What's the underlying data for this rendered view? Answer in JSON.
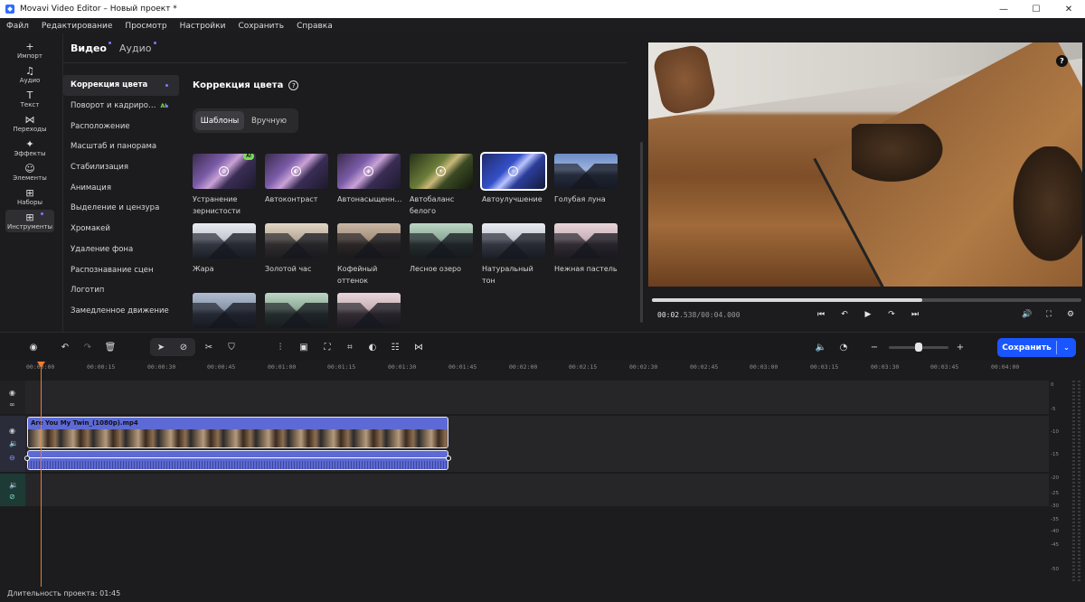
{
  "window": {
    "title": "Movavi Video Editor – Новый проект *",
    "min": "—",
    "max": "☐",
    "close": "✕"
  },
  "menu": [
    "Файл",
    "Редактирование",
    "Просмотр",
    "Настройки",
    "Сохранить",
    "Справка"
  ],
  "rail": [
    {
      "label": "Импорт",
      "icon": "+"
    },
    {
      "label": "Аудио",
      "icon": "♫"
    },
    {
      "label": "Текст",
      "icon": "T"
    },
    {
      "label": "Переходы",
      "icon": "⋈"
    },
    {
      "label": "Эффекты",
      "icon": "✦"
    },
    {
      "label": "Элементы",
      "icon": "☺"
    },
    {
      "label": "Наборы",
      "icon": "⊞"
    },
    {
      "label": "Инструменты",
      "icon": "⊞"
    }
  ],
  "tabs": {
    "video": "Видео",
    "audio": "Аудио"
  },
  "sidemenu": [
    "Коррекция цвета",
    "Поворот и кадриро…",
    "Расположение",
    "Масштаб и панорама",
    "Стабилизация",
    "Анимация",
    "Выделение и цензура",
    "Хромакей",
    "Удаление фона",
    "Распознавание сцен",
    "Логотип",
    "Замедленное движение"
  ],
  "ai_tag": "AI",
  "section": {
    "title": "Коррекция цвета",
    "help": "?"
  },
  "segment": {
    "templates": "Шаблоны",
    "manual": "Вручную"
  },
  "presets": [
    {
      "name": "Устранение зернистости",
      "badge": "AI",
      "icon": "◍"
    },
    {
      "name": "Автоконтраст",
      "icon": "◐"
    },
    {
      "name": "Автонасыщенн…",
      "icon": "◈"
    },
    {
      "name": "Автобаланс белого",
      "icon": "☀"
    },
    {
      "name": "Автоулучшение",
      "icon": "✧"
    },
    {
      "name": "Голубая луна"
    },
    {
      "name": "Жара"
    },
    {
      "name": "Золотой час"
    },
    {
      "name": "Кофейный оттенок"
    },
    {
      "name": "Лесное озеро"
    },
    {
      "name": "Натуральный тон"
    },
    {
      "name": "Нежная пастель"
    },
    {
      "name": ""
    },
    {
      "name": ""
    },
    {
      "name": ""
    }
  ],
  "preview": {
    "help": "?",
    "time_current": "00:02",
    "time_rest": ".538/00:04.000",
    "progress_fraction": 0.63
  },
  "ruler": [
    "00:00:00",
    "00:00:15",
    "00:00:30",
    "00:00:45",
    "00:01:00",
    "00:01:15",
    "00:01:30",
    "00:01:45",
    "00:02:00",
    "00:02:15",
    "00:02:30",
    "00:02:45",
    "00:03:00",
    "00:03:15",
    "00:03:30",
    "00:03:45",
    "00:04:00"
  ],
  "clip": {
    "name": "Are You My Twin_(1080p).mp4"
  },
  "meter": [
    "0",
    "-5",
    "-10",
    "-15",
    "-20",
    "-25",
    "-30",
    "-35",
    "-40",
    "-45",
    "-50"
  ],
  "toolbar": {
    "save": "Сохранить",
    "save_chevron": "⌄"
  },
  "status": {
    "duration": "Длительность проекта: 01:45"
  },
  "colors": {
    "accent": "#1a56ff",
    "clip": "#5d6ad6",
    "playhead": "#f07b2a",
    "ai": "#7dd957"
  }
}
